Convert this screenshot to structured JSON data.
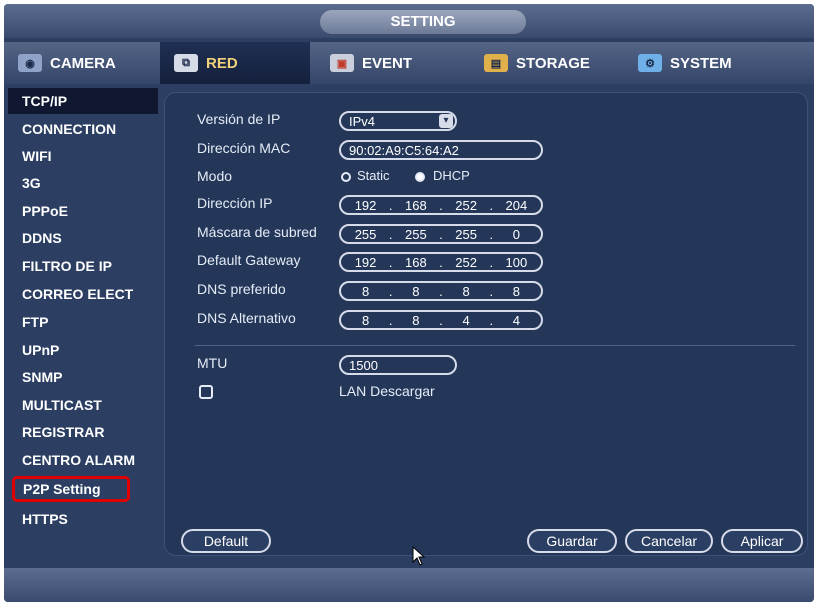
{
  "window": {
    "title": "SETTING"
  },
  "tabs": [
    {
      "label": "CAMERA",
      "icon": "camera-icon"
    },
    {
      "label": "RED",
      "icon": "network-icon",
      "active": true
    },
    {
      "label": "EVENT",
      "icon": "event-icon"
    },
    {
      "label": "STORAGE",
      "icon": "storage-icon"
    },
    {
      "label": "SYSTEM",
      "icon": "system-icon"
    }
  ],
  "sidebar": {
    "items": [
      {
        "label": "TCP/IP"
      },
      {
        "label": "CONNECTION"
      },
      {
        "label": "WIFI"
      },
      {
        "label": "3G"
      },
      {
        "label": "PPPoE"
      },
      {
        "label": "DDNS"
      },
      {
        "label": "FILTRO DE IP"
      },
      {
        "label": "CORREO ELECT"
      },
      {
        "label": "FTP"
      },
      {
        "label": "UPnP"
      },
      {
        "label": "SNMP"
      },
      {
        "label": "MULTICAST"
      },
      {
        "label": "REGISTRAR"
      },
      {
        "label": "CENTRO ALARM"
      },
      {
        "label": "P2P Setting"
      },
      {
        "label": "HTTPS"
      }
    ],
    "active": "TCP/IP",
    "highlighted": "P2P Setting",
    "highlight_color": "#e00000"
  },
  "form": {
    "ip_version": {
      "label": "Versión de IP",
      "value": "IPv4"
    },
    "mac": {
      "label": "Dirección MAC",
      "value": "90:02:A9:C5:64:A2"
    },
    "mode": {
      "label": "Modo",
      "static_label": "Static",
      "dhcp_label": "DHCP",
      "selected": "DHCP"
    },
    "ip_address": {
      "label": "Dirección IP",
      "octets": [
        "192",
        "168",
        "252",
        "204"
      ]
    },
    "subnet": {
      "label": "Máscara de subred",
      "octets": [
        "255",
        "255",
        "255",
        "0"
      ]
    },
    "gateway": {
      "label": "Default Gateway",
      "octets": [
        "192",
        "168",
        "252",
        "100"
      ]
    },
    "dns_primary": {
      "label": "DNS preferido",
      "octets": [
        "8",
        "8",
        "8",
        "8"
      ]
    },
    "dns_alternate": {
      "label": "DNS Alternativo",
      "octets": [
        "8",
        "8",
        "4",
        "4"
      ]
    },
    "mtu": {
      "label": "MTU",
      "value": "1500"
    },
    "lan_download": {
      "label": "LAN Descargar",
      "checked": false
    }
  },
  "buttons": {
    "default": "Default",
    "save": "Guardar",
    "cancel": "Cancelar",
    "apply": "Aplicar"
  },
  "colors": {
    "background": "#2c3f63",
    "panel": "#243759",
    "active_tab_text": "#f0d27a"
  }
}
